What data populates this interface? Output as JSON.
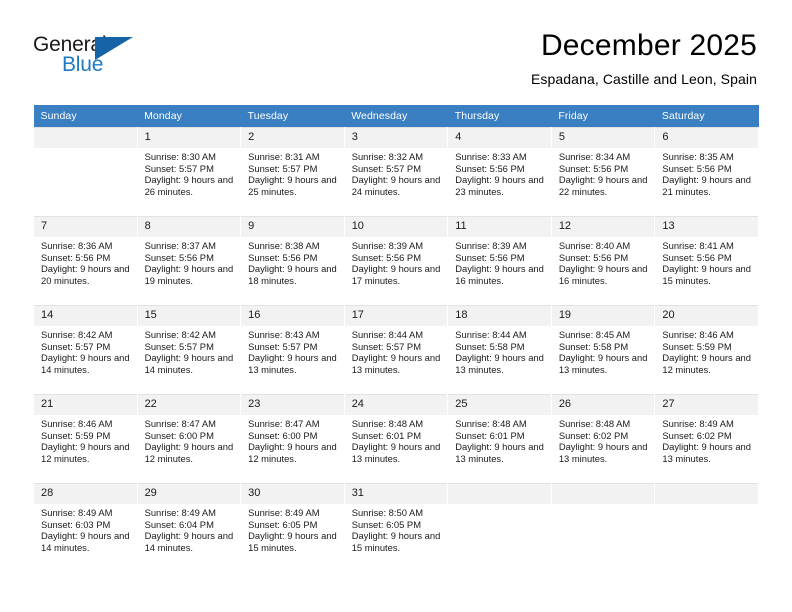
{
  "brand": {
    "name_top": "General",
    "name_bottom": "Blue",
    "accent_color": "#1663a8",
    "text_color": "#1f7ac4"
  },
  "header": {
    "title": "December 2025",
    "subtitle": "Espadana, Castille and Leon, Spain"
  },
  "calendar": {
    "header_bg": "#3a7fc1",
    "daynum_bg": "#f2f2f2",
    "weekday_headers": [
      "Sunday",
      "Monday",
      "Tuesday",
      "Wednesday",
      "Thursday",
      "Friday",
      "Saturday"
    ],
    "weeks": [
      [
        {
          "day": "",
          "sunrise": "",
          "sunset": "",
          "daylight": "",
          "empty": true
        },
        {
          "day": "1",
          "sunrise": "Sunrise: 8:30 AM",
          "sunset": "Sunset: 5:57 PM",
          "daylight": "Daylight: 9 hours and 26 minutes."
        },
        {
          "day": "2",
          "sunrise": "Sunrise: 8:31 AM",
          "sunset": "Sunset: 5:57 PM",
          "daylight": "Daylight: 9 hours and 25 minutes."
        },
        {
          "day": "3",
          "sunrise": "Sunrise: 8:32 AM",
          "sunset": "Sunset: 5:57 PM",
          "daylight": "Daylight: 9 hours and 24 minutes."
        },
        {
          "day": "4",
          "sunrise": "Sunrise: 8:33 AM",
          "sunset": "Sunset: 5:56 PM",
          "daylight": "Daylight: 9 hours and 23 minutes."
        },
        {
          "day": "5",
          "sunrise": "Sunrise: 8:34 AM",
          "sunset": "Sunset: 5:56 PM",
          "daylight": "Daylight: 9 hours and 22 minutes."
        },
        {
          "day": "6",
          "sunrise": "Sunrise: 8:35 AM",
          "sunset": "Sunset: 5:56 PM",
          "daylight": "Daylight: 9 hours and 21 minutes."
        }
      ],
      [
        {
          "day": "7",
          "sunrise": "Sunrise: 8:36 AM",
          "sunset": "Sunset: 5:56 PM",
          "daylight": "Daylight: 9 hours and 20 minutes."
        },
        {
          "day": "8",
          "sunrise": "Sunrise: 8:37 AM",
          "sunset": "Sunset: 5:56 PM",
          "daylight": "Daylight: 9 hours and 19 minutes."
        },
        {
          "day": "9",
          "sunrise": "Sunrise: 8:38 AM",
          "sunset": "Sunset: 5:56 PM",
          "daylight": "Daylight: 9 hours and 18 minutes."
        },
        {
          "day": "10",
          "sunrise": "Sunrise: 8:39 AM",
          "sunset": "Sunset: 5:56 PM",
          "daylight": "Daylight: 9 hours and 17 minutes."
        },
        {
          "day": "11",
          "sunrise": "Sunrise: 8:39 AM",
          "sunset": "Sunset: 5:56 PM",
          "daylight": "Daylight: 9 hours and 16 minutes."
        },
        {
          "day": "12",
          "sunrise": "Sunrise: 8:40 AM",
          "sunset": "Sunset: 5:56 PM",
          "daylight": "Daylight: 9 hours and 16 minutes."
        },
        {
          "day": "13",
          "sunrise": "Sunrise: 8:41 AM",
          "sunset": "Sunset: 5:56 PM",
          "daylight": "Daylight: 9 hours and 15 minutes."
        }
      ],
      [
        {
          "day": "14",
          "sunrise": "Sunrise: 8:42 AM",
          "sunset": "Sunset: 5:57 PM",
          "daylight": "Daylight: 9 hours and 14 minutes."
        },
        {
          "day": "15",
          "sunrise": "Sunrise: 8:42 AM",
          "sunset": "Sunset: 5:57 PM",
          "daylight": "Daylight: 9 hours and 14 minutes."
        },
        {
          "day": "16",
          "sunrise": "Sunrise: 8:43 AM",
          "sunset": "Sunset: 5:57 PM",
          "daylight": "Daylight: 9 hours and 13 minutes."
        },
        {
          "day": "17",
          "sunrise": "Sunrise: 8:44 AM",
          "sunset": "Sunset: 5:57 PM",
          "daylight": "Daylight: 9 hours and 13 minutes."
        },
        {
          "day": "18",
          "sunrise": "Sunrise: 8:44 AM",
          "sunset": "Sunset: 5:58 PM",
          "daylight": "Daylight: 9 hours and 13 minutes."
        },
        {
          "day": "19",
          "sunrise": "Sunrise: 8:45 AM",
          "sunset": "Sunset: 5:58 PM",
          "daylight": "Daylight: 9 hours and 13 minutes."
        },
        {
          "day": "20",
          "sunrise": "Sunrise: 8:46 AM",
          "sunset": "Sunset: 5:59 PM",
          "daylight": "Daylight: 9 hours and 12 minutes."
        }
      ],
      [
        {
          "day": "21",
          "sunrise": "Sunrise: 8:46 AM",
          "sunset": "Sunset: 5:59 PM",
          "daylight": "Daylight: 9 hours and 12 minutes."
        },
        {
          "day": "22",
          "sunrise": "Sunrise: 8:47 AM",
          "sunset": "Sunset: 6:00 PM",
          "daylight": "Daylight: 9 hours and 12 minutes."
        },
        {
          "day": "23",
          "sunrise": "Sunrise: 8:47 AM",
          "sunset": "Sunset: 6:00 PM",
          "daylight": "Daylight: 9 hours and 12 minutes."
        },
        {
          "day": "24",
          "sunrise": "Sunrise: 8:48 AM",
          "sunset": "Sunset: 6:01 PM",
          "daylight": "Daylight: 9 hours and 13 minutes."
        },
        {
          "day": "25",
          "sunrise": "Sunrise: 8:48 AM",
          "sunset": "Sunset: 6:01 PM",
          "daylight": "Daylight: 9 hours and 13 minutes."
        },
        {
          "day": "26",
          "sunrise": "Sunrise: 8:48 AM",
          "sunset": "Sunset: 6:02 PM",
          "daylight": "Daylight: 9 hours and 13 minutes."
        },
        {
          "day": "27",
          "sunrise": "Sunrise: 8:49 AM",
          "sunset": "Sunset: 6:02 PM",
          "daylight": "Daylight: 9 hours and 13 minutes."
        }
      ],
      [
        {
          "day": "28",
          "sunrise": "Sunrise: 8:49 AM",
          "sunset": "Sunset: 6:03 PM",
          "daylight": "Daylight: 9 hours and 14 minutes."
        },
        {
          "day": "29",
          "sunrise": "Sunrise: 8:49 AM",
          "sunset": "Sunset: 6:04 PM",
          "daylight": "Daylight: 9 hours and 14 minutes."
        },
        {
          "day": "30",
          "sunrise": "Sunrise: 8:49 AM",
          "sunset": "Sunset: 6:05 PM",
          "daylight": "Daylight: 9 hours and 15 minutes."
        },
        {
          "day": "31",
          "sunrise": "Sunrise: 8:50 AM",
          "sunset": "Sunset: 6:05 PM",
          "daylight": "Daylight: 9 hours and 15 minutes."
        },
        {
          "day": "",
          "sunrise": "",
          "sunset": "",
          "daylight": "",
          "blank": true
        },
        {
          "day": "",
          "sunrise": "",
          "sunset": "",
          "daylight": "",
          "blank": true
        },
        {
          "day": "",
          "sunrise": "",
          "sunset": "",
          "daylight": "",
          "blank": true
        }
      ]
    ]
  }
}
